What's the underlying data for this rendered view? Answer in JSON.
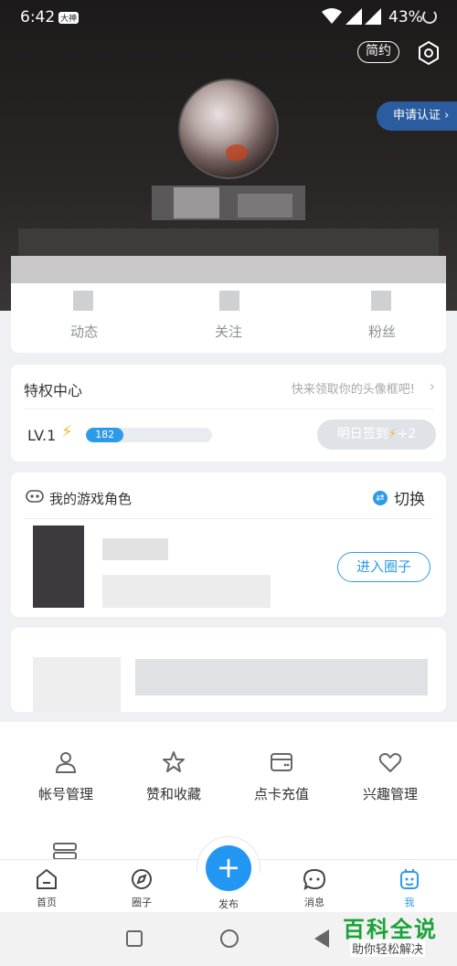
{
  "status_bar": {
    "time": "6:42",
    "app_badge": "大神",
    "battery": "43%"
  },
  "header": {
    "simple_label": "简约",
    "cert_label": "申请认证"
  },
  "stats": [
    {
      "label": "动态"
    },
    {
      "label": "关注"
    },
    {
      "label": "粉丝"
    }
  ],
  "privilege": {
    "title": "特权中心",
    "hint": "快来领取你的头像框吧!",
    "level": "LV.1",
    "xp": "182",
    "xp_fraction": 0.3,
    "signin_label": "明日签到",
    "signin_bonus": "+2"
  },
  "game_role": {
    "title": "我的游戏角色",
    "switch_label": "切换",
    "enter_label": "进入圈子"
  },
  "tools": [
    {
      "label": "帐号管理",
      "icon": "person-icon"
    },
    {
      "label": "赞和收藏",
      "icon": "star-icon"
    },
    {
      "label": "点卡充值",
      "icon": "card-icon"
    },
    {
      "label": "兴趣管理",
      "icon": "heart-icon"
    }
  ],
  "bottom_nav": {
    "home": "首页",
    "circle": "圈子",
    "post": "发布",
    "messages": "消息",
    "me": "我"
  },
  "watermark": {
    "title": "百科全说",
    "subtitle": "助你轻松解决"
  },
  "colors": {
    "accent": "#2d9be8",
    "header_bg": "#1c1a1a",
    "cert_bg": "#2c5ca0"
  }
}
